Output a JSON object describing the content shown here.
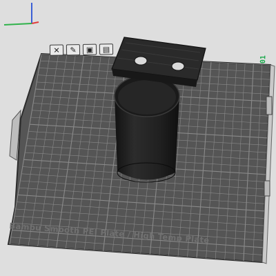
{
  "plate": {
    "name_label": "Bambu Smooth PEI Plate / High Temp Plate",
    "index_label": "01",
    "colors": {
      "plate": "#555555",
      "grid_line": "#8a8a8a",
      "plate_edge": "#2c2c2c",
      "background": "#dedede",
      "model": "#1e1e1e",
      "index_text": "#18a84a"
    }
  },
  "plate_toolbar": {
    "tools": [
      {
        "name": "close-plate-icon",
        "glyph": "✕"
      },
      {
        "name": "arrange-plate-icon",
        "glyph": "✎"
      },
      {
        "name": "plate-settings-icon",
        "glyph": "▣"
      },
      {
        "name": "lock-plate-icon",
        "glyph": "▤"
      }
    ]
  },
  "axes": {
    "x_color": "#e03c3c",
    "y_color": "#2fb24a",
    "z_color": "#3a5fd6"
  }
}
